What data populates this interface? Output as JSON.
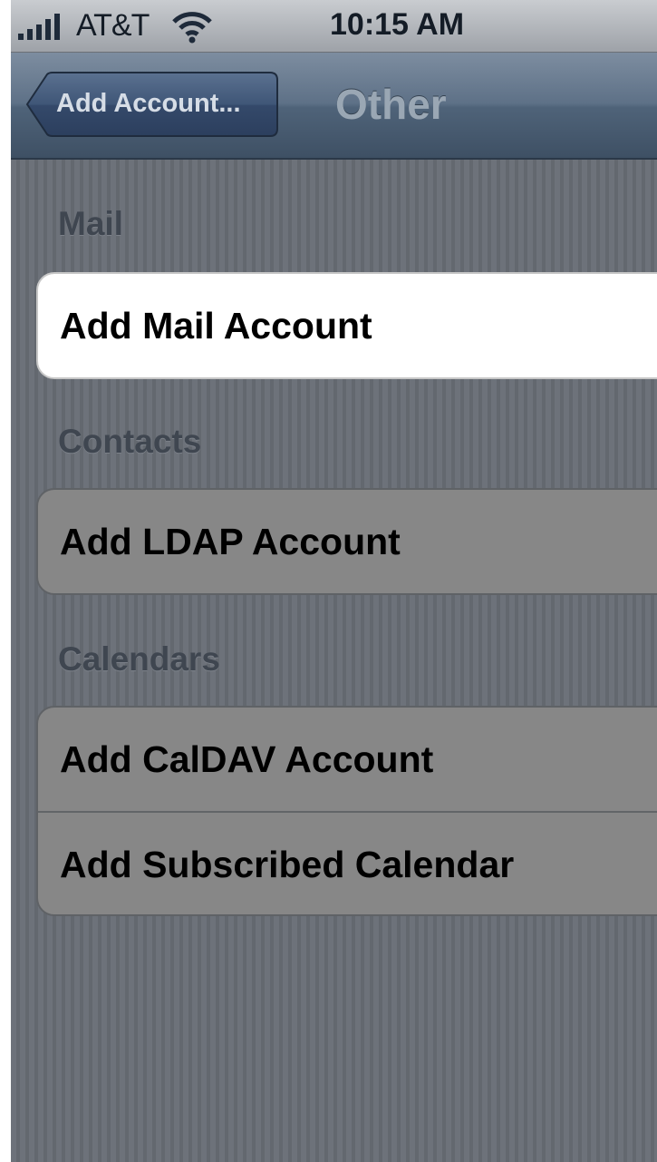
{
  "status_bar": {
    "carrier": "AT&T",
    "time": "10:15 AM",
    "signal_icon": "signal-bars-icon",
    "wifi_icon": "wifi-icon"
  },
  "nav_bar": {
    "back_label": "Add Account...",
    "title": "Other"
  },
  "sections": {
    "mail": {
      "header": "Mail",
      "items": [
        "Add Mail Account"
      ]
    },
    "contacts": {
      "header": "Contacts",
      "items": [
        "Add LDAP Account"
      ]
    },
    "calendars": {
      "header": "Calendars",
      "items": [
        "Add CalDAV Account",
        "Add Subscribed Calendar"
      ]
    }
  },
  "colors": {
    "nav_bar": "#5e7187",
    "background_stripes": "#6b7078",
    "selected_cell": "#ffffff",
    "dimmed_cell": "#878787"
  }
}
